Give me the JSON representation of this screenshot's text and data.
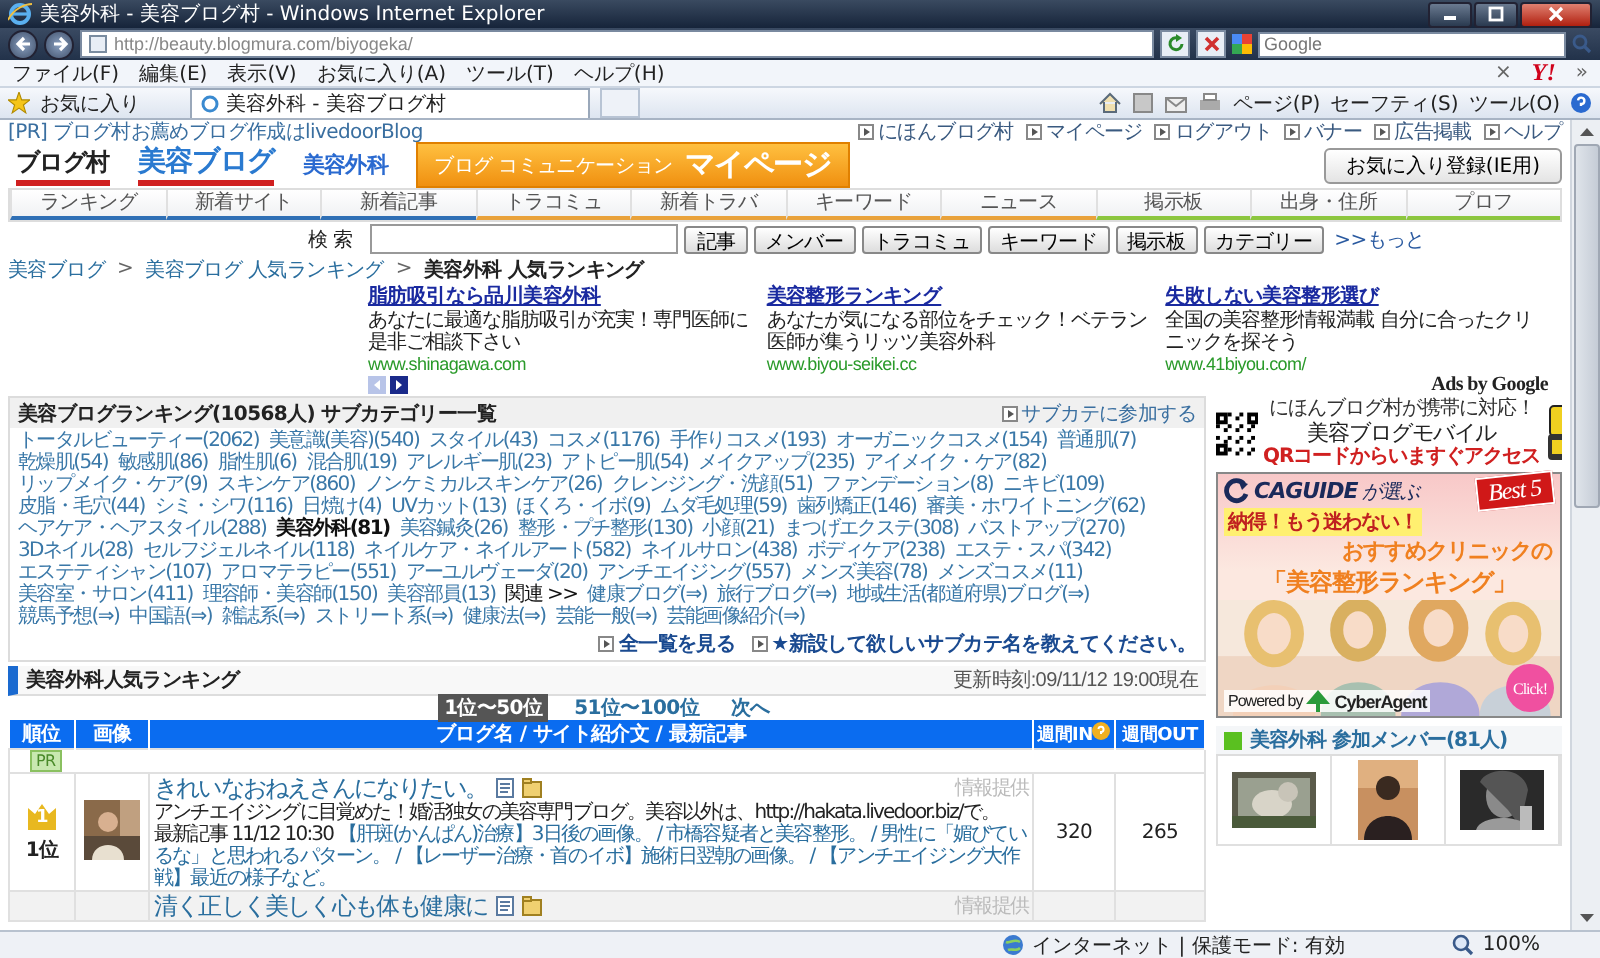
{
  "window": {
    "title": "美容外科 - 美容ブログ村 - Windows Internet Explorer"
  },
  "address_bar": {
    "url": "http://beauty.blogmura.com/biyogeka/"
  },
  "search_box": {
    "placeholder": "Google"
  },
  "menu": [
    "ファイル(F)",
    "編集(E)",
    "表示(V)",
    "お気に入り(A)",
    "ツール(T)",
    "ヘルプ(H)"
  ],
  "menu_extras": {
    "close": "×",
    "logo": "Y!",
    "more": "»"
  },
  "favorites": {
    "label": "お気に入り"
  },
  "browser_tab": {
    "title": "美容外科 - 美容ブログ村"
  },
  "command_bar": [
    "ページ(P)",
    "セーフティ(S)",
    "ツール(O)"
  ],
  "top_strip": {
    "pr": "[PR] ブログ村お薦めブログ作成はlivedoorBlog",
    "links": [
      "にほんブログ村",
      "マイページ",
      "ログアウト",
      "バナー",
      "広告掲載",
      "ヘルプ"
    ]
  },
  "logos": {
    "site": "ブログ村",
    "category": "美容ブログ",
    "subcategory": "美容外科",
    "mypage_small": "ブログ コミュニケーション",
    "mypage": "マイページ"
  },
  "favorite_button": "お気に入り登録(IE用)",
  "nav_tabs": [
    {
      "label": "ランキング",
      "color": "#2f6fb5"
    },
    {
      "label": "新着サイト",
      "color": "#2f6fb5"
    },
    {
      "label": "新着記事",
      "color": "#2f6fb5"
    },
    {
      "label": "トラコミュ",
      "color": "#e9a23b"
    },
    {
      "label": "新着トラバ",
      "color": "#e9a23b"
    },
    {
      "label": "キーワード",
      "color": "#e9a23b"
    },
    {
      "label": "ニュース",
      "color": "#e9a23b"
    },
    {
      "label": "掲示板",
      "color": "#8cc63f"
    },
    {
      "label": "出身・住所",
      "color": "#8cc63f"
    },
    {
      "label": "プロフ",
      "color": "#8cc63f"
    }
  ],
  "site_search": {
    "label": "検 索",
    "buttons": [
      "記事",
      "メンバー",
      "トラコミュ",
      "キーワード",
      "掲示板",
      "カテゴリー"
    ],
    "more": ">>もっと"
  },
  "breadcrumb": [
    {
      "label": "美容ブログ",
      "kind": "link"
    },
    {
      "label": ">",
      "kind": "sep"
    },
    {
      "label": "美容ブログ 人気ランキング",
      "kind": "link"
    },
    {
      "label": ">",
      "kind": "sep"
    },
    {
      "label": "美容外科 人気ランキング",
      "kind": "current"
    }
  ],
  "ads": {
    "items": [
      {
        "title": "脂肪吸引なら品川美容外科",
        "text": "あなたに最適な脂肪吸引が充実！専門医師に是非ご相談下さい",
        "url": "www.shinagawa.com"
      },
      {
        "title": "美容整形ランキング",
        "text": "あなたが気になる部位をチェック！ベテラン医師が集うリッツ美容外科",
        "url": "www.biyou-seikei.cc"
      },
      {
        "title": "失敗しない美容整形選び",
        "text": "全国の美容整形情報満載 自分に合ったクリニックを探そう",
        "url": "www.41biyou.com/"
      }
    ],
    "attribution": "Ads by Google"
  },
  "category_box": {
    "title": "美容ブログランキング(10568人) サブカテゴリー一覧",
    "join": "サブカテに参加する",
    "items": [
      {
        "label": "トータルビューティー(2062)",
        "kind": "link",
        "selected": false
      },
      {
        "label": "美意識(美容)(540)",
        "kind": "link",
        "selected": false
      },
      {
        "label": "スタイル(43)",
        "kind": "link",
        "selected": false
      },
      {
        "label": "コスメ(1176)",
        "kind": "link",
        "selected": false
      },
      {
        "label": "手作りコスメ(193)",
        "kind": "link",
        "selected": false
      },
      {
        "label": "オーガニックコスメ(154)",
        "kind": "link",
        "selected": false
      },
      {
        "label": "普通肌(7)",
        "kind": "link",
        "selected": false
      },
      {
        "label": "乾燥肌(54)",
        "kind": "link",
        "selected": false
      },
      {
        "label": "敏感肌(86)",
        "kind": "link",
        "selected": false
      },
      {
        "label": "脂性肌(6)",
        "kind": "link",
        "selected": false
      },
      {
        "label": "混合肌(19)",
        "kind": "link",
        "selected": false
      },
      {
        "label": "アレルギー肌(23)",
        "kind": "link",
        "selected": false
      },
      {
        "label": "アトピー肌(54)",
        "kind": "link",
        "selected": false
      },
      {
        "label": "メイクアップ(235)",
        "kind": "link",
        "selected": false
      },
      {
        "label": "アイメイク・ケア(82)",
        "kind": "link",
        "selected": false
      },
      {
        "label": "リップメイク・ケア(9)",
        "kind": "link",
        "selected": false
      },
      {
        "label": "スキンケア(860)",
        "kind": "link",
        "selected": false
      },
      {
        "label": "ノンケミカルスキンケア(26)",
        "kind": "link",
        "selected": false
      },
      {
        "label": "クレンジング・洗顔(51)",
        "kind": "link",
        "selected": false
      },
      {
        "label": "ファンデーション(8)",
        "kind": "link",
        "selected": false
      },
      {
        "label": "ニキビ(109)",
        "kind": "link",
        "selected": false
      },
      {
        "label": "皮脂・毛穴(44)",
        "kind": "link",
        "selected": false
      },
      {
        "label": "シミ・シワ(116)",
        "kind": "link",
        "selected": false
      },
      {
        "label": "日焼け(4)",
        "kind": "link",
        "selected": false
      },
      {
        "label": "UVカット(13)",
        "kind": "link",
        "selected": false
      },
      {
        "label": "ほくろ・イボ(9)",
        "kind": "link",
        "selected": false
      },
      {
        "label": "ムダ毛処理(59)",
        "kind": "link",
        "selected": false
      },
      {
        "label": "歯列矯正(146)",
        "kind": "link",
        "selected": false
      },
      {
        "label": "審美・ホワイトニング(62)",
        "kind": "link",
        "selected": false
      },
      {
        "label": "ヘアケア・ヘアスタイル(288)",
        "kind": "link",
        "selected": false
      },
      {
        "label": "美容外科(81)",
        "kind": "link",
        "selected": true
      },
      {
        "label": "美容鍼灸(26)",
        "kind": "link",
        "selected": false
      },
      {
        "label": "整形・プチ整形(130)",
        "kind": "link",
        "selected": false
      },
      {
        "label": "小顔(21)",
        "kind": "link",
        "selected": false
      },
      {
        "label": "まつげエクステ(308)",
        "kind": "link",
        "selected": false
      },
      {
        "label": "バストアップ(270)",
        "kind": "link",
        "selected": false
      },
      {
        "label": "3Dネイル(28)",
        "kind": "link",
        "selected": false
      },
      {
        "label": "セルフジェルネイル(118)",
        "kind": "link",
        "selected": false
      },
      {
        "label": "ネイルケア・ネイルアート(582)",
        "kind": "link",
        "selected": false
      },
      {
        "label": "ネイルサロン(438)",
        "kind": "link",
        "selected": false
      },
      {
        "label": "ボディケア(238)",
        "kind": "link",
        "selected": false
      },
      {
        "label": "エステ・スパ(342)",
        "kind": "link",
        "selected": false
      },
      {
        "label": "エステティシャン(107)",
        "kind": "link",
        "selected": false
      },
      {
        "label": "アロマテラピー(551)",
        "kind": "link",
        "selected": false
      },
      {
        "label": "アーユルヴェーダ(20)",
        "kind": "link",
        "selected": false
      },
      {
        "label": "アンチエイジング(557)",
        "kind": "link",
        "selected": false
      },
      {
        "label": "メンズ美容(78)",
        "kind": "link",
        "selected": false
      },
      {
        "label": "メンズコスメ(11)",
        "kind": "link",
        "selected": false
      },
      {
        "label": "美容室・サロン(411)",
        "kind": "link",
        "selected": false
      },
      {
        "label": "理容師・美容師(150)",
        "kind": "link",
        "selected": false
      },
      {
        "label": "美容部員(13)",
        "kind": "link",
        "selected": false
      },
      {
        "label": "関連 >>",
        "kind": "label"
      },
      {
        "label": "健康ブログ(⇒)",
        "kind": "link",
        "selected": false
      },
      {
        "label": "旅行ブログ(⇒)",
        "kind": "link",
        "selected": false
      },
      {
        "label": "地域生活(都道府県)ブログ(⇒)",
        "kind": "link",
        "selected": false
      },
      {
        "label": "競馬予想(⇒)",
        "kind": "link",
        "selected": false
      },
      {
        "label": "中国語(⇒)",
        "kind": "link",
        "selected": false
      },
      {
        "label": "雑誌系(⇒)",
        "kind": "link",
        "selected": false
      },
      {
        "label": "ストリート系(⇒)",
        "kind": "link",
        "selected": false
      },
      {
        "label": "健康法(⇒)",
        "kind": "link",
        "selected": false
      },
      {
        "label": "芸能一般(⇒)",
        "kind": "link",
        "selected": false
      },
      {
        "label": "芸能画像紹介(⇒)",
        "kind": "link",
        "selected": false
      }
    ],
    "footer": [
      "全一覧を見る",
      "★新設して欲しいサブカテ名を教えてください。"
    ]
  },
  "ranking": {
    "title": "美容外科人気ランキング",
    "updated": "更新時刻:09/11/12 19:00現在",
    "pages": [
      {
        "label": "1位〜50位",
        "selected": true
      },
      {
        "label": "51位〜100位",
        "selected": false
      },
      {
        "label": "次へ",
        "selected": false
      }
    ],
    "columns": [
      "順位",
      "画像",
      "ブログ名 / サイト紹介文 / 最新記事",
      "週間IN",
      "週間OUT"
    ],
    "pr_badge": "PR",
    "rows": [
      {
        "rank": "1位",
        "crown": "1",
        "title": "きれいなおねえさんになりたい。",
        "info": "情報提供",
        "description": "アンチエイジングに目覚めた！婚活独女の美容専門ブログ。美容以外は、http://hakata.livedoor.biz/で。",
        "latest_label": "最新記事",
        "latest_time": "11/12 10:30",
        "latest": "【肝斑(かんぱん)治療】3日後の画像。 / 市橋容疑者と美容整形。 / 男性に「媚びているな」と思われるパターン。 / 【レーザー治療・首のイボ】施術日翌朝の画像。 / 【アンチエイジング大作戦】最近の様子など。",
        "in": "320",
        "out": "265"
      },
      {
        "title": "清く正しく美しく心も体も健康に",
        "info": "情報提供"
      }
    ]
  },
  "mobile": {
    "line1": "にほんブログ村が携帯に対応！",
    "line2": "美容ブログモバイル",
    "line3": "QRコードからいますぐアクセス"
  },
  "banner": {
    "brand": "CAGUIDE",
    "brand_suffix": "が選ぶ",
    "badge": "Best 5",
    "tagline": "納得！もう迷わない！",
    "line1": "おすすめクリニックの",
    "line2": "「美容整形ランキング」",
    "powered": "Powered by",
    "sponsor": "CyberAgent",
    "click": "Click!"
  },
  "members": {
    "title": "美容外科 参加メンバー(81人)"
  },
  "status_bar": {
    "zone": "インターネット | 保護モード: 有効",
    "zoom": "100%"
  }
}
